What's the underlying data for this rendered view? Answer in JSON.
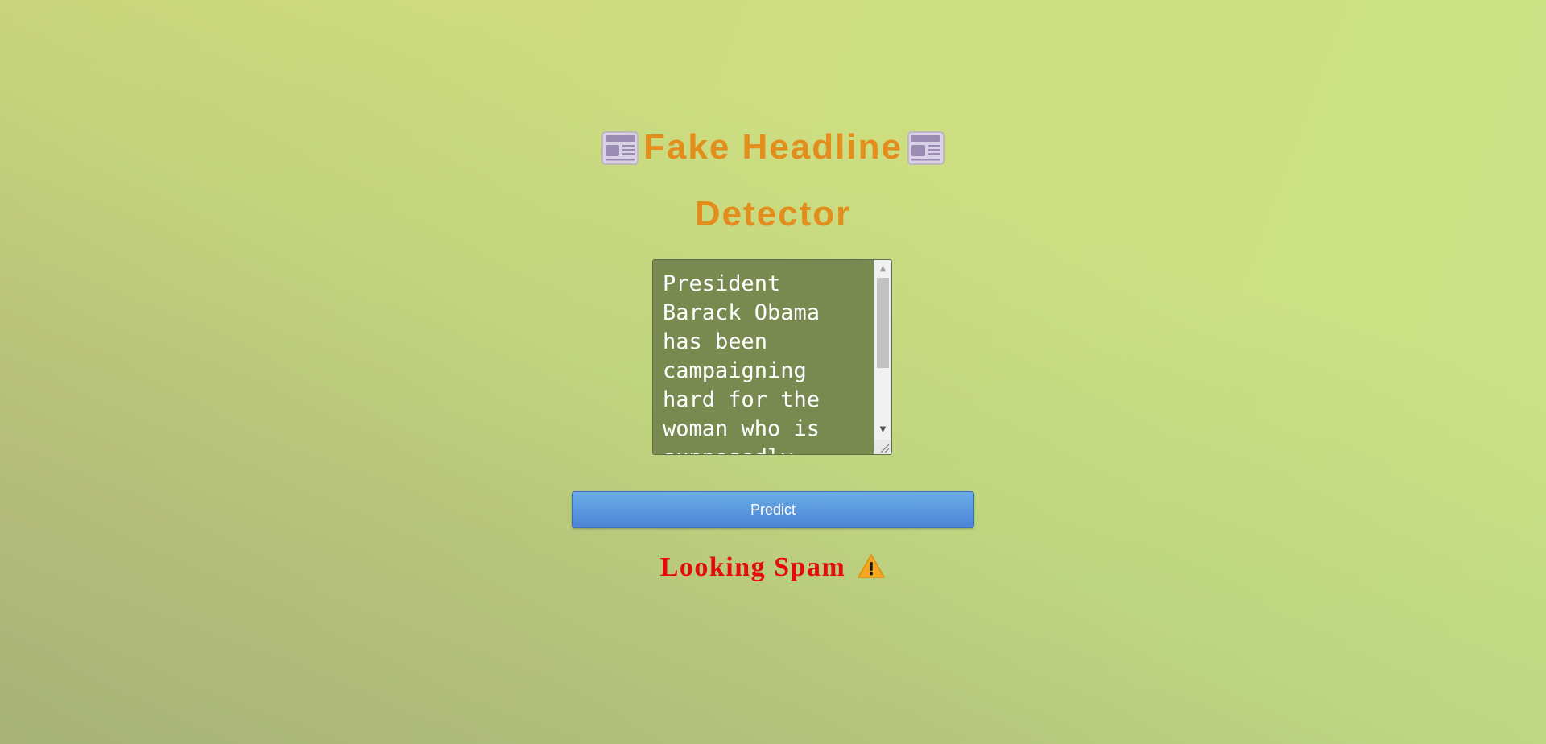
{
  "header": {
    "title_line1": "Fake Headline",
    "title_line2": "Detector",
    "title_icon": "newspaper-icon"
  },
  "input": {
    "value": "President Barack Obama has been campaigning hard for the woman who is supposedly"
  },
  "predict_button": {
    "label": "Predict"
  },
  "result": {
    "text": "Looking Spam",
    "icon": "warning-icon",
    "color": "#e60b0b"
  },
  "colors": {
    "title": "#e38d1c",
    "button": "#4c83d4",
    "textarea_bg": "#788a50"
  }
}
